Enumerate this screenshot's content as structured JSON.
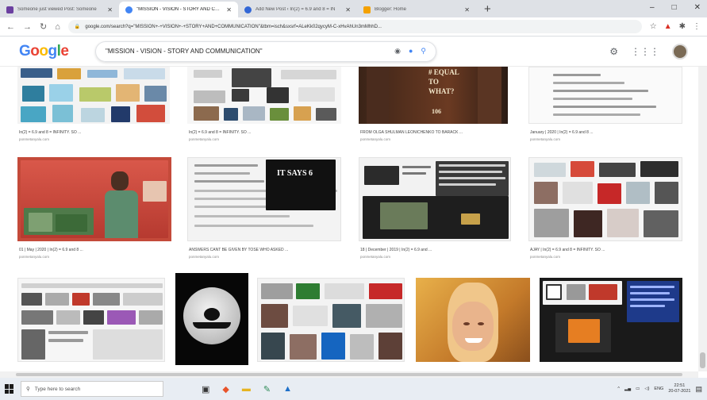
{
  "tabs": [
    {
      "title": "Someone just viewed Post: Someone",
      "color": "#6b3fa0",
      "active": false
    },
    {
      "title": "\"MISSION - VISION - STORY AND COMM",
      "color": "#4285f4",
      "active": true
    },
    {
      "title": "Add New Post ‹ In(2) = 6.9 and 8 = IN",
      "color": "#3367d6",
      "active": false
    },
    {
      "title": "Blogger: Home",
      "color": "#f4a100",
      "active": false
    }
  ],
  "window": {
    "minimize": "–",
    "maximize": "□",
    "close": "✕"
  },
  "toolbar": {
    "back": "←",
    "forward": "→",
    "reload": "↻",
    "home": "⌂",
    "url": "google.com/search?q=\"MISSION+-+VISION+-+STORY+AND+COMMUNICATION\"&tbm=isch&sxsrf=ALeKk02qycyM-C-xHvAhUn3mMhhD..."
  },
  "google": {
    "logo": [
      "G",
      "o",
      "o",
      "g",
      "l",
      "e"
    ],
    "query": "\"MISSION - VISION - STORY AND COMMUNICATION\""
  },
  "results": [
    {
      "caption": "In(2) = 6.9 and 8 = INFINITY. SO ...",
      "source": "ponmetanyalu.com"
    },
    {
      "caption": "In(2) = 6.9 and 8 = INFINITY. SO ...",
      "source": "ponmetanyalu.com"
    },
    {
      "caption": "FROM OLGA SHULMAN LEONICHENKO TO BARACK ...",
      "source": "ponmetanyalu.com",
      "overlay": [
        "# EQUAL",
        "TO",
        "WHAT?",
        "106"
      ]
    },
    {
      "caption": "January | 2020 | In(2) = 6.9 and 8 ...",
      "source": "ponmetanyalu.com"
    },
    {
      "caption": "01 | May | 2020 | In(2) = 6.9 and 8 ...",
      "source": "ponmetanyalu.com"
    },
    {
      "caption": "ANSWERS CANT BE GIVEN BY TOSE WHO ASKED ...",
      "source": "ponmetanyalu.com",
      "overlay": [
        "IT SAYS 6"
      ]
    },
    {
      "caption": "18 | December | 2019 | In(2) = 6.9 and ...",
      "source": "ponmetanyalu.com"
    },
    {
      "caption": "AJAY | In(2) = 6.9 and 8 = INFINITY. SO ...",
      "source": "ponmetanyalu.com"
    },
    {
      "caption": "",
      "source": ""
    },
    {
      "caption": "",
      "source": ""
    },
    {
      "caption": "",
      "source": ""
    },
    {
      "caption": "",
      "source": ""
    },
    {
      "caption": "",
      "source": ""
    }
  ],
  "taskbar": {
    "search_placeholder": "Type here to search",
    "lang": "ENG",
    "time": "22:51",
    "date": "20-07-2021"
  }
}
